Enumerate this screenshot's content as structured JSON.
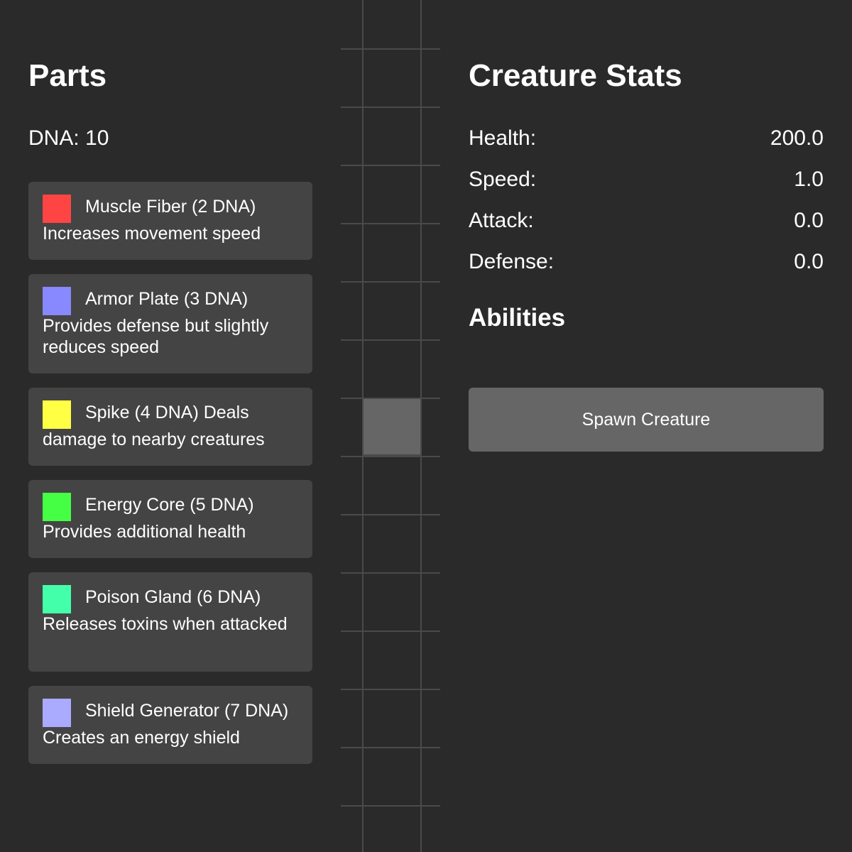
{
  "parts_panel": {
    "title": "Parts",
    "dna_label": "DNA: 10",
    "parts": [
      {
        "name": "Muscle Fiber (2 DNA)",
        "description": "Increases movement speed",
        "color": "#ff4444",
        "icon": "red-color-swatch"
      },
      {
        "name": "Armor Plate (3 DNA)",
        "description": "Provides defense but slightly reduces speed",
        "color": "#8888ff",
        "icon": "blue-color-swatch"
      },
      {
        "name": "Spike (4 DNA)",
        "description": "Deals damage to nearby creatures",
        "color": "#ffff44",
        "icon": "yellow-color-swatch"
      },
      {
        "name": "Energy Core (5 DNA)",
        "description": "Provides additional health",
        "color": "#44ff44",
        "icon": "green-color-swatch"
      },
      {
        "name": "Poison Gland (6 DNA)",
        "description": "Releases toxins when attacked",
        "color": "#44ffaa",
        "icon": "teal-color-swatch"
      },
      {
        "name": "Shield Generator (7 DNA)",
        "description": "Creates an energy shield",
        "color": "#aaaaff",
        "icon": "lavender-color-swatch"
      }
    ]
  },
  "stats_panel": {
    "title": "Creature Stats",
    "stats": [
      {
        "label": "Health:",
        "value": "200.0"
      },
      {
        "label": "Speed:",
        "value": "1.0"
      },
      {
        "label": "Attack:",
        "value": "0.0"
      },
      {
        "label": "Defense:",
        "value": "0.0"
      }
    ],
    "abilities_title": "Abilities",
    "spawn_button_label": "Spawn Creature"
  },
  "colors": {
    "background": "#2a2a2a",
    "card": "#444444",
    "button": "#666666",
    "grid_line": "#4a4a4a",
    "filled_cell": "#666666"
  }
}
